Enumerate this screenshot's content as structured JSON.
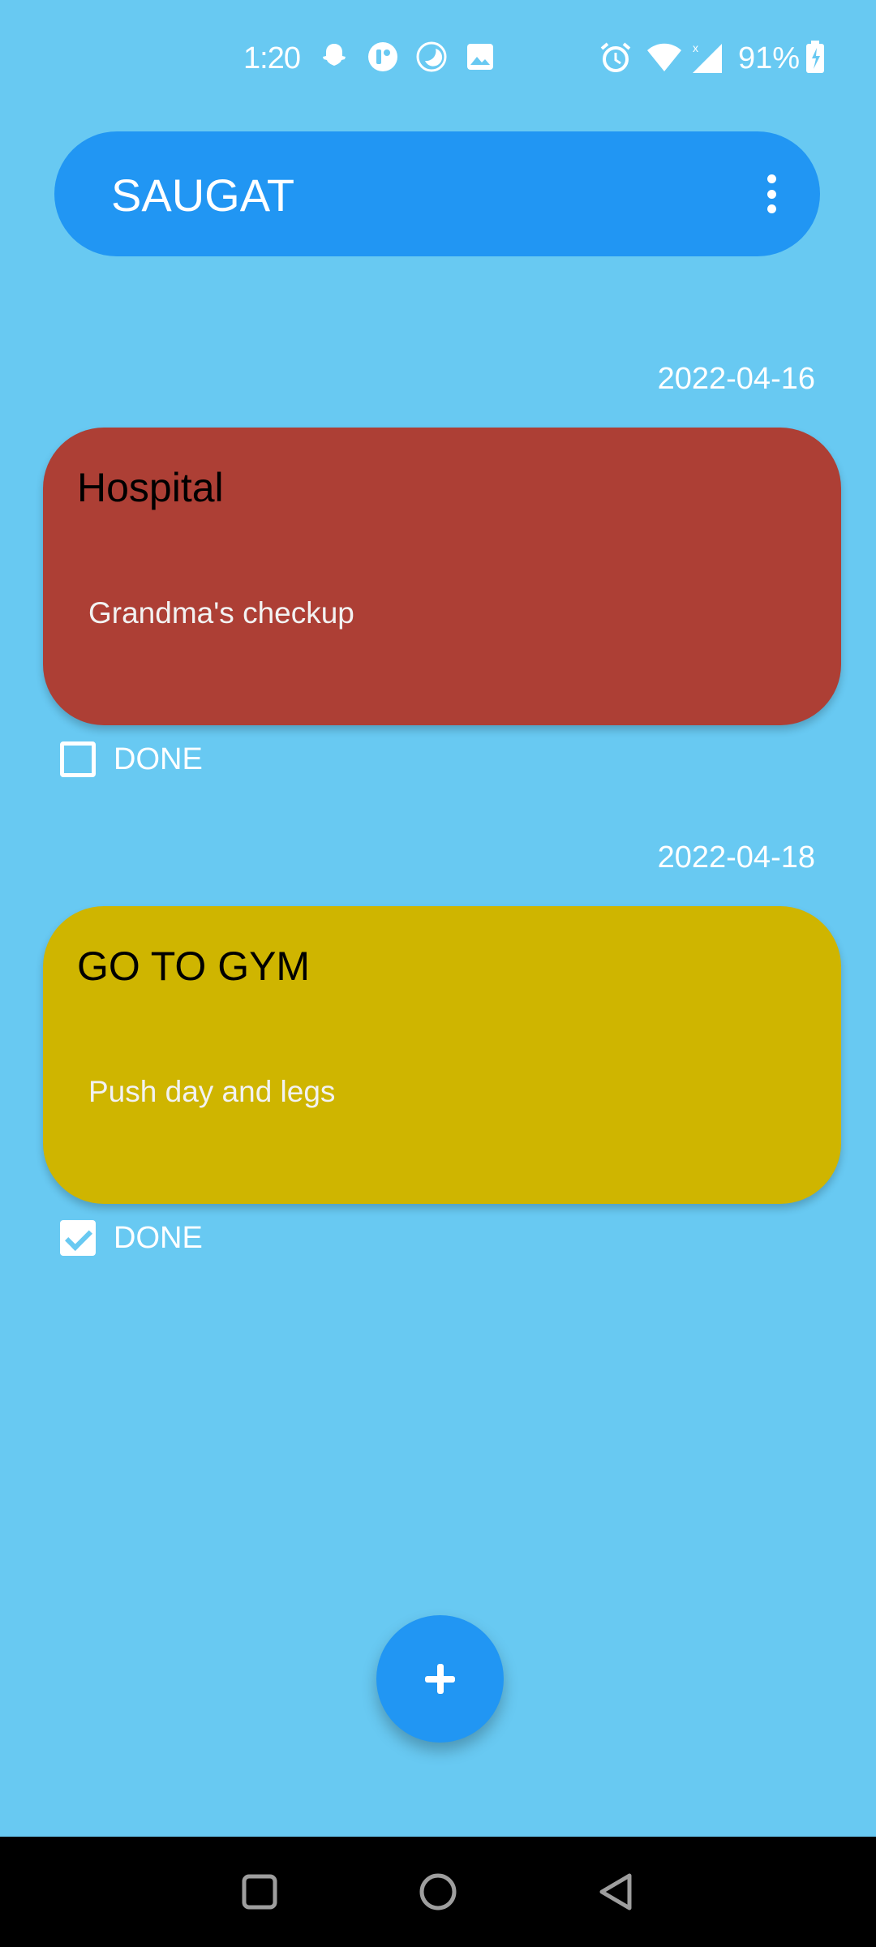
{
  "status_bar": {
    "time": "1:20",
    "battery": "91%",
    "left_icons": [
      "snapchat-icon",
      "app-icon",
      "moon-icon",
      "image-icon"
    ],
    "right_icons": [
      "alarm-icon",
      "wifi-icon",
      "signal-icon",
      "battery-icon"
    ]
  },
  "app_bar": {
    "title": "SAUGAT",
    "menu_icon": "more-vertical-icon",
    "color": "#2196f3"
  },
  "tasks": [
    {
      "date": "2022-04-16",
      "title": "Hospital",
      "description": "Grandma's checkup",
      "color": "#ad3f35",
      "done_label": "DONE",
      "done": false
    },
    {
      "date": "2022-04-18",
      "title": "GO TO GYM",
      "description": "Push day and legs",
      "color": "#cfb500",
      "done_label": "DONE",
      "done": true
    }
  ],
  "fab": {
    "icon": "plus-icon"
  },
  "nav_bar": {
    "icons": [
      "recent-apps-icon",
      "home-icon",
      "back-icon"
    ]
  },
  "colors": {
    "background": "#68c9f2",
    "accent": "#2196f3"
  }
}
